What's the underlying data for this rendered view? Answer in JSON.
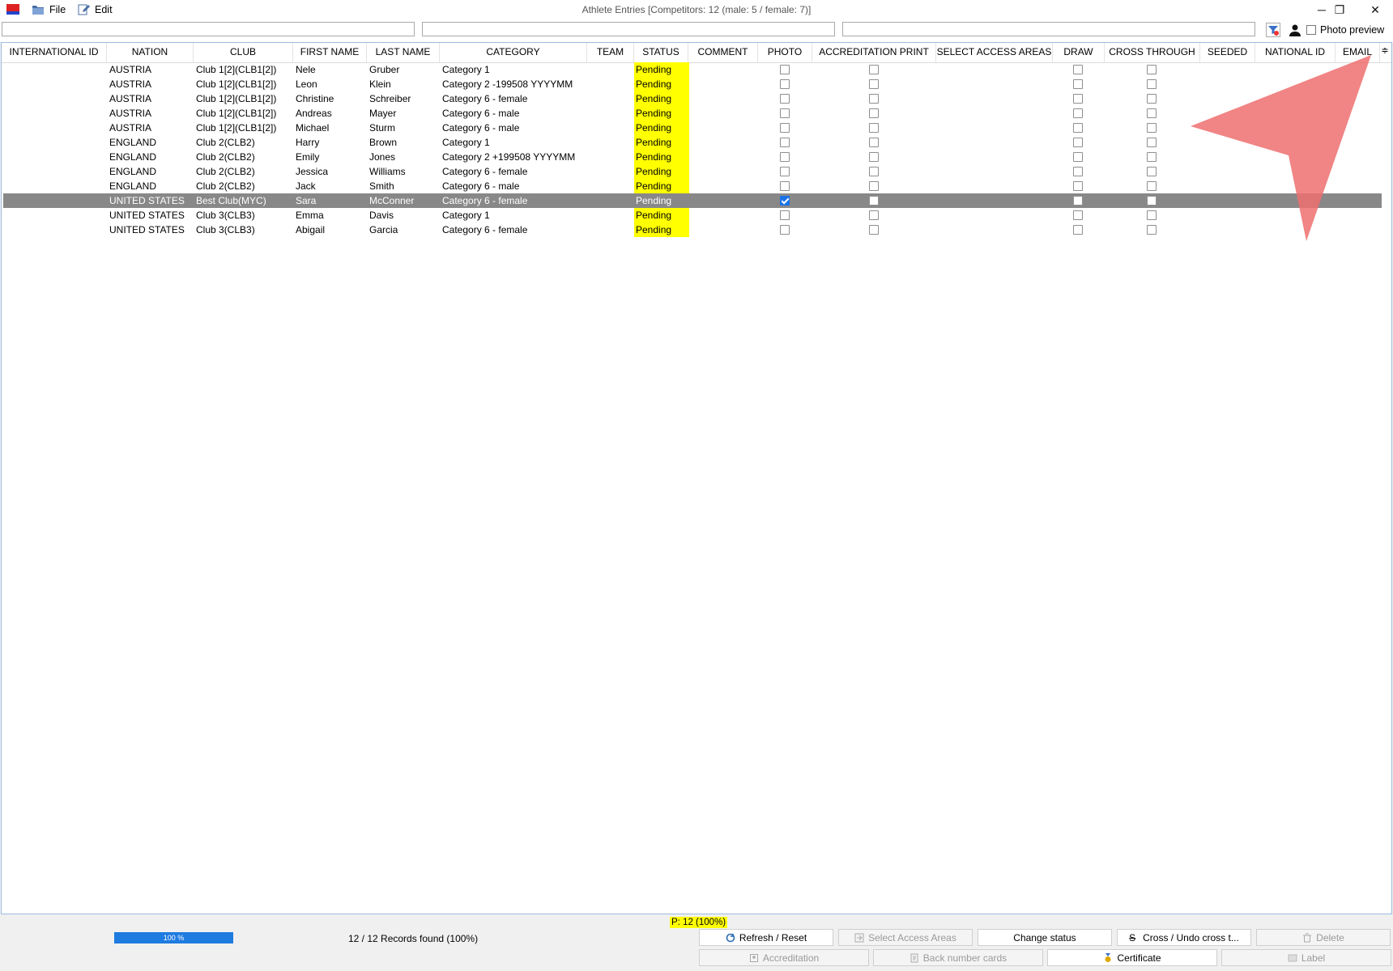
{
  "window": {
    "title": "Athlete Entries [Competitors: 12 (male: 5 / female: 7)]",
    "menu": [
      {
        "label": "File",
        "icon": "folder-icon"
      },
      {
        "label": "Edit",
        "icon": "edit-icon"
      }
    ],
    "controls": {
      "minimize": "─",
      "restore": "❐",
      "close": "✕"
    }
  },
  "filters": {
    "photo_preview_label": "Photo preview",
    "photo_preview_checked": false
  },
  "columns": [
    "INTERNATIONAL ID",
    "NATION",
    "CLUB",
    "FIRST NAME",
    "LAST NAME",
    "CATEGORY",
    "TEAM",
    "STATUS",
    "COMMENT",
    "PHOTO",
    "ACCREDITATION PRINT",
    "SELECT ACCESS AREAS",
    "DRAW",
    "CROSS THROUGH",
    "SEEDED",
    "NATIONAL ID",
    "EMAIL"
  ],
  "column_toggle_icon": "≑",
  "rows": [
    {
      "nation": "AUSTRIA",
      "club": "Club 1[2](CLB1[2])",
      "first": "Nele",
      "last": "Gruber",
      "category": "Category 1",
      "status": "Pending",
      "photo": false,
      "acc": false,
      "draw": false,
      "cross": false,
      "selected": false
    },
    {
      "nation": "AUSTRIA",
      "club": "Club 1[2](CLB1[2])",
      "first": "Leon",
      "last": "Klein",
      "category": "Category 2 -199508 YYYYMM",
      "status": "Pending",
      "photo": false,
      "acc": false,
      "draw": false,
      "cross": false,
      "selected": false
    },
    {
      "nation": "AUSTRIA",
      "club": "Club 1[2](CLB1[2])",
      "first": "Christine",
      "last": "Schreiber",
      "category": "Category 6 - female",
      "status": "Pending",
      "photo": false,
      "acc": false,
      "draw": false,
      "cross": false,
      "selected": false
    },
    {
      "nation": "AUSTRIA",
      "club": "Club 1[2](CLB1[2])",
      "first": "Andreas",
      "last": "Mayer",
      "category": "Category 6 - male",
      "status": "Pending",
      "photo": false,
      "acc": false,
      "draw": false,
      "cross": false,
      "selected": false
    },
    {
      "nation": "AUSTRIA",
      "club": "Club 1[2](CLB1[2])",
      "first": "Michael",
      "last": "Sturm",
      "category": "Category 6 - male",
      "status": "Pending",
      "photo": false,
      "acc": false,
      "draw": false,
      "cross": false,
      "selected": false
    },
    {
      "nation": "ENGLAND",
      "club": "Club 2(CLB2)",
      "first": "Harry",
      "last": "Brown",
      "category": "Category 1",
      "status": "Pending",
      "photo": false,
      "acc": false,
      "draw": false,
      "cross": false,
      "selected": false
    },
    {
      "nation": "ENGLAND",
      "club": "Club 2(CLB2)",
      "first": "Emily",
      "last": "Jones",
      "category": "Category 2 +199508 YYYYMM",
      "status": "Pending",
      "photo": false,
      "acc": false,
      "draw": false,
      "cross": false,
      "selected": false
    },
    {
      "nation": "ENGLAND",
      "club": "Club 2(CLB2)",
      "first": "Jessica",
      "last": "Williams",
      "category": "Category 6 - female",
      "status": "Pending",
      "photo": false,
      "acc": false,
      "draw": false,
      "cross": false,
      "selected": false
    },
    {
      "nation": "ENGLAND",
      "club": "Club 2(CLB2)",
      "first": "Jack",
      "last": "Smith",
      "category": "Category 6 - male",
      "status": "Pending",
      "photo": false,
      "acc": false,
      "draw": false,
      "cross": false,
      "selected": false
    },
    {
      "nation": "UNITED STATES",
      "club": "Best Club(MYC)",
      "first": "Sara",
      "last": "McConner",
      "category": "Category 6 - female",
      "status": "Pending",
      "photo": true,
      "acc": false,
      "draw": false,
      "cross": false,
      "selected": true
    },
    {
      "nation": "UNITED STATES",
      "club": "Club 3(CLB3)",
      "first": "Emma",
      "last": "Davis",
      "category": "Category 1",
      "status": "Pending",
      "photo": false,
      "acc": false,
      "draw": false,
      "cross": false,
      "selected": false
    },
    {
      "nation": "UNITED STATES",
      "club": "Club 3(CLB3)",
      "first": "Abigail",
      "last": "Garcia",
      "category": "Category 6 - female",
      "status": "Pending",
      "photo": false,
      "acc": false,
      "draw": false,
      "cross": false,
      "selected": false
    }
  ],
  "footer": {
    "p_count": "P: 12 (100%)",
    "progress_label": "100 %",
    "progress_fraction": 1.0,
    "records": "12 / 12 Records found (100%)",
    "buttons_row1": [
      {
        "label": "Refresh / Reset",
        "enabled": true,
        "icon": "refresh-icon"
      },
      {
        "label": "Select Access Areas",
        "enabled": false,
        "icon": "access-icon"
      },
      {
        "label": "Change status",
        "enabled": true,
        "icon": ""
      },
      {
        "label": "Cross / Undo cross t...",
        "enabled": true,
        "icon": "strikethrough-icon"
      },
      {
        "label": "Delete",
        "enabled": false,
        "icon": "trash-icon"
      }
    ],
    "buttons_row2": [
      {
        "label": "Accreditation",
        "enabled": false,
        "icon": "badge-icon"
      },
      {
        "label": "Back number cards",
        "enabled": false,
        "icon": "document-icon"
      },
      {
        "label": "Certificate",
        "enabled": true,
        "icon": "medal-icon"
      },
      {
        "label": "Label",
        "enabled": false,
        "icon": "label-icon"
      }
    ]
  },
  "colors": {
    "status_pending": "#ffff00",
    "selected_row": "#888888",
    "accent": "#1e7be0",
    "cursor_arrow": "#ee6e6e"
  }
}
